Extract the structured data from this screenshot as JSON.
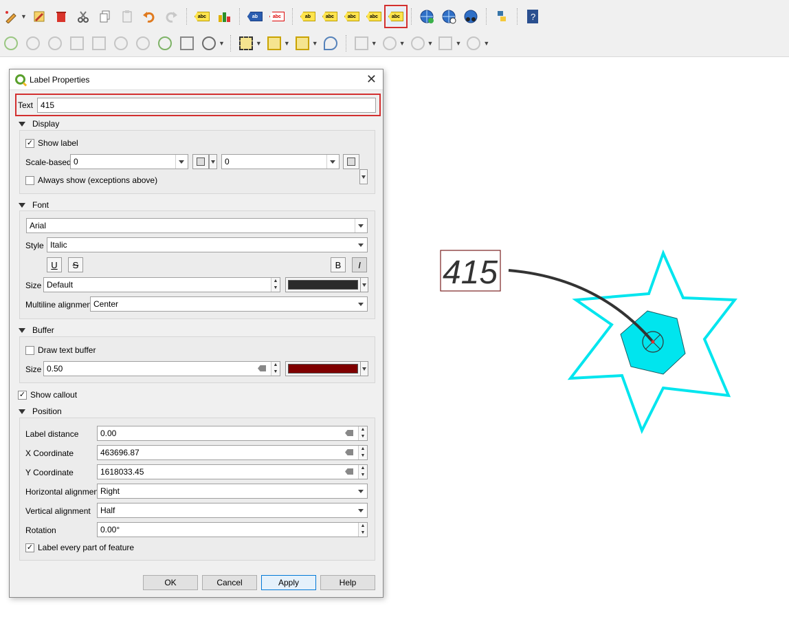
{
  "toolbar": {
    "row1": [
      {
        "name": "digitize-pencil-icon",
        "type": "btn"
      },
      {
        "name": "edit-pencil-icon",
        "type": "btn"
      },
      {
        "name": "delete-icon",
        "type": "btn"
      },
      {
        "name": "cut-icon",
        "type": "btn"
      },
      {
        "name": "copy-icon",
        "type": "btn"
      },
      {
        "name": "paste-icon",
        "type": "btn"
      },
      {
        "name": "undo-icon",
        "type": "btn"
      },
      {
        "name": "redo-icon",
        "type": "btn"
      },
      {
        "name": "label-toolbar-icon",
        "type": "abc"
      },
      {
        "name": "diagram-toolbar-icon",
        "type": "btn"
      },
      {
        "name": "pin-label-icon",
        "type": "abc-blue"
      },
      {
        "name": "highlight-pinned-icon",
        "type": "abc-red"
      },
      {
        "name": "pin-unpin-label-icon",
        "type": "abc"
      },
      {
        "name": "show-hide-label-icon",
        "type": "abc"
      },
      {
        "name": "move-label-icon",
        "type": "abc"
      },
      {
        "name": "rotate-label-icon",
        "type": "abc"
      },
      {
        "name": "change-label-properties-icon",
        "type": "abc-active"
      },
      {
        "name": "globe-add-icon",
        "type": "btn"
      },
      {
        "name": "globe-search-icon",
        "type": "btn"
      },
      {
        "name": "globe-binoculars-icon",
        "type": "btn"
      },
      {
        "name": "python-console-icon",
        "type": "btn"
      },
      {
        "name": "help-icon",
        "type": "btn"
      }
    ]
  },
  "dialog": {
    "title": "Label Properties",
    "text_label": "Text",
    "text_value": "415",
    "display": {
      "header": "Display",
      "show_label": "Show label",
      "show_label_checked": true,
      "scale_based_label": "Scale-based",
      "scale_min": "0",
      "scale_max": "0",
      "always_show": "Always show (exceptions above)",
      "always_show_checked": false
    },
    "font": {
      "header": "Font",
      "family": "Arial",
      "style_label": "Style",
      "style_value": "Italic",
      "underline": "U",
      "strikeout": "S",
      "bold": "B",
      "italic": "I",
      "size_label": "Size",
      "size_value": "Default",
      "font_color": "#2b2b2b",
      "multiline_label": "Multiline alignment",
      "multiline_value": "Center"
    },
    "buffer": {
      "header": "Buffer",
      "draw_buffer": "Draw text buffer",
      "draw_buffer_checked": false,
      "size_label": "Size",
      "size_value": "0.50",
      "buffer_color": "#7f0000"
    },
    "show_callout": "Show callout",
    "show_callout_checked": true,
    "position": {
      "header": "Position",
      "label_distance_label": "Label distance",
      "label_distance": "0.00",
      "x_label": "X Coordinate",
      "x_value": "463696.87",
      "y_label": "Y Coordinate",
      "y_value": "1618033.45",
      "halign_label": "Horizontal alignment",
      "halign_value": "Right",
      "valign_label": "Vertical alignment",
      "valign_value": "Half",
      "rotation_label": "Rotation",
      "rotation_value": "0.00°",
      "every_part": "Label every part of feature",
      "every_part_checked": true
    },
    "buttons": {
      "ok": "OK",
      "cancel": "Cancel",
      "apply": "Apply",
      "help": "Help"
    }
  },
  "map": {
    "label_text": "415",
    "star_color": "#00e5ee",
    "hexagon_color": "#00e5ee",
    "callout_color": "#333333"
  }
}
